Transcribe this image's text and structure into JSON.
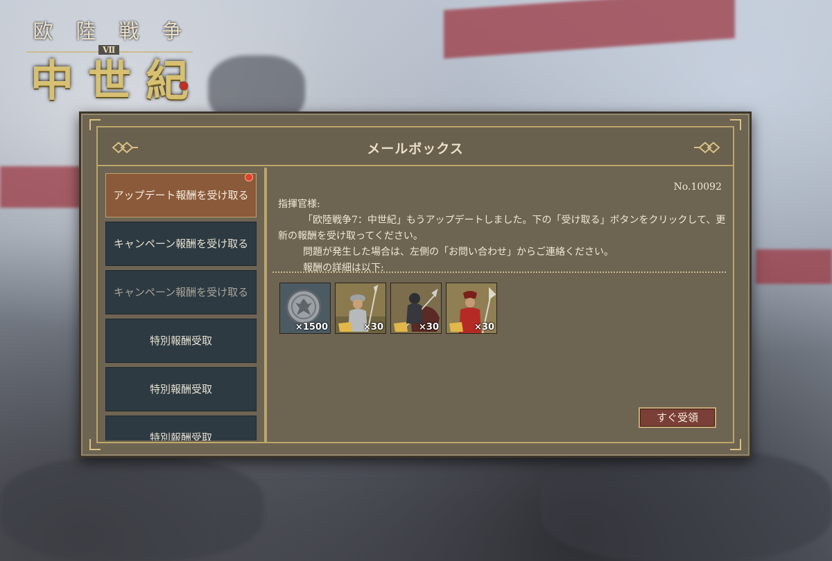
{
  "logo": {
    "top_chars": [
      "欧",
      "陸",
      "戦",
      "争"
    ],
    "numeral": "Ⅶ",
    "main_chars": [
      "中",
      "世",
      "紀"
    ]
  },
  "dialog": {
    "title": "メールボックス",
    "mail_number": "No.10092",
    "tabs": [
      {
        "label": "アップデート報酬を受け取る",
        "state": "active",
        "unread": true
      },
      {
        "label": "キャンペーン報酬を受け取る",
        "state": "normal"
      },
      {
        "label": "キャンペーン報酬を受け取る",
        "state": "dim"
      },
      {
        "label": "特別報酬受取",
        "state": "normal"
      },
      {
        "label": "特別報酬受取",
        "state": "normal"
      },
      {
        "label": "特別報酬受取",
        "state": "normal"
      }
    ],
    "body": {
      "salutation": "指揮官様:",
      "line1": "「欧陸戦争7：中世紀」もうアップデートしました。下の「受け取る」ボタンをクリックして、更新の報酬を受け取ってください。",
      "line2": "問題が発生した場合は、左側の「お問い合わせ」からご連絡ください。",
      "line3": "報酬の詳細は以下:"
    },
    "rewards": [
      {
        "icon": "silver-coin-icon",
        "qty": "×1500"
      },
      {
        "icon": "spearman-icon",
        "qty": "×30"
      },
      {
        "icon": "knight-cavalry-icon",
        "qty": "×30"
      },
      {
        "icon": "halberdier-icon",
        "qty": "×30"
      }
    ],
    "claim_label": "すぐ受領"
  },
  "colors": {
    "panel": "#6e6452",
    "gold_trim": "#bca76b",
    "tab": "#2d3a42",
    "tab_active": "#8b5a3a",
    "button": "#7a3f36",
    "unread_dot": "#e0412a"
  }
}
